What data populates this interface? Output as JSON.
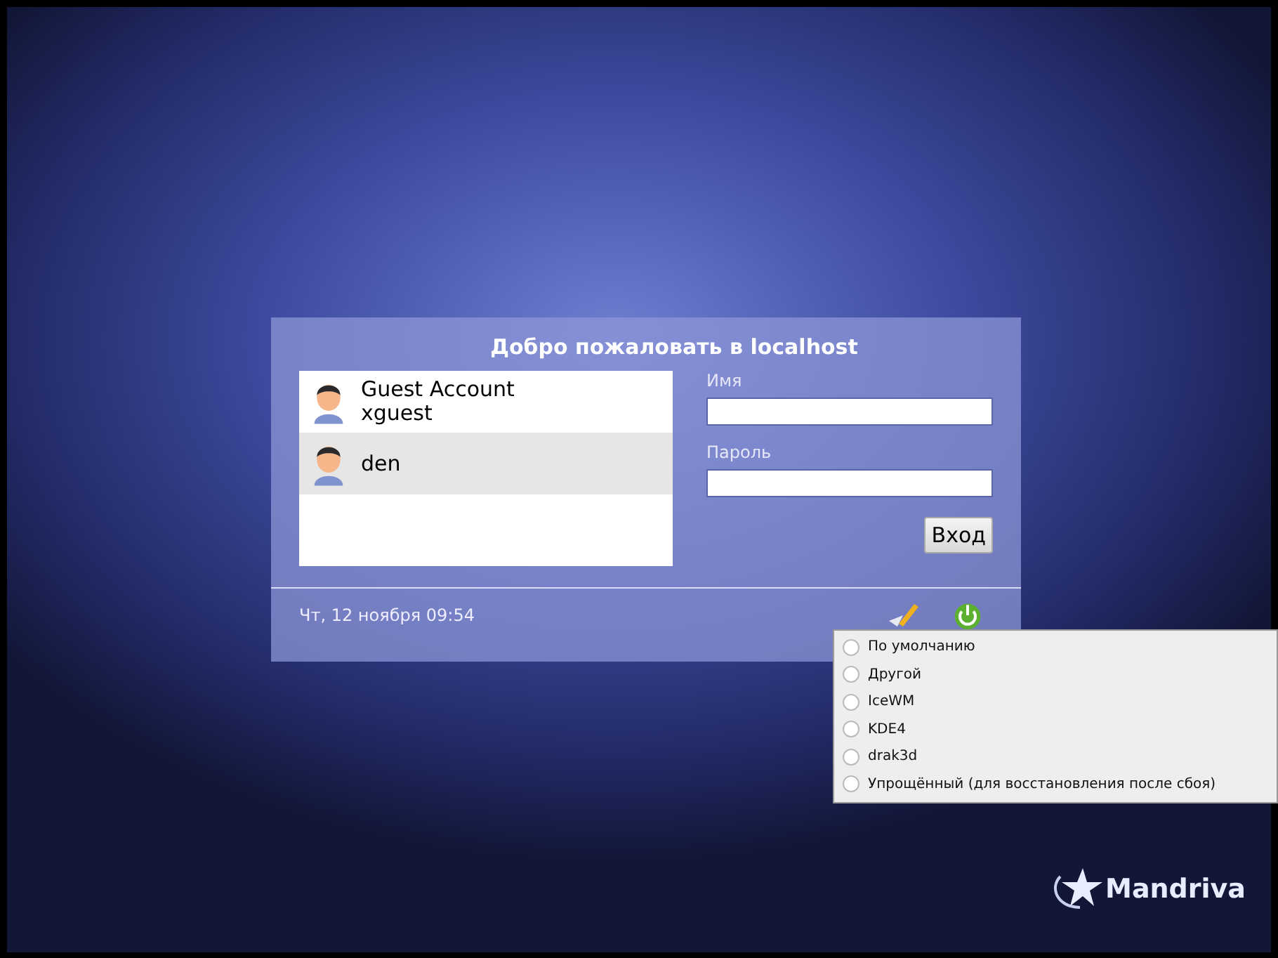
{
  "dialog": {
    "title": "Добро пожаловать в localhost",
    "users": [
      {
        "name": "Guest Account",
        "login": "xguest",
        "selected": false
      },
      {
        "name": "den",
        "selected": true
      }
    ],
    "username": {
      "label": "Имя"
    },
    "password": {
      "label": "Пароль"
    },
    "login_button": "Вход",
    "datetime": "Чт, 12 ноября 09:54"
  },
  "session_menu": [
    {
      "label": "По умолчанию",
      "checked": false
    },
    {
      "label": "Другой",
      "checked": false
    },
    {
      "label": "IceWM",
      "checked": false
    },
    {
      "label": "KDE4",
      "checked": false
    },
    {
      "label": "drak3d",
      "checked": false
    },
    {
      "label": "Упрощённый (для восстановления после сбоя)",
      "checked": false
    }
  ],
  "logo": {
    "text": "Mandriva"
  }
}
